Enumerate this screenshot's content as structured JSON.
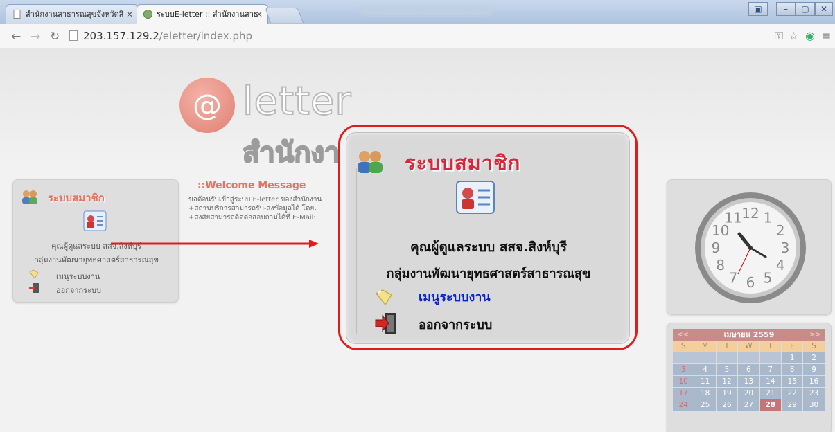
{
  "browser": {
    "tabs": [
      {
        "title": "สำนักงานสาธารณสุขจังหวัดสิ",
        "active": false
      },
      {
        "title": "ระบบE-letter :: สำนักงานสาธ",
        "active": true
      }
    ],
    "url_host": "203.157.129.2",
    "url_path": "/eletter/index.php"
  },
  "header": {
    "logo_symbol": "@",
    "logo_word": "letter",
    "logo_sub": "สำนักงาน"
  },
  "member_panel": {
    "title": "ระบบสมาชิก",
    "user_name": "คุณผู้ดูแลระบบ สสจ.สิงห์บุรี",
    "group": "กลุ่มงานพัฒนายุทธศาสตร์สาธารณสุข",
    "menu_label": "เมนูระบบงาน",
    "logout_label": "ออกจากระบบ"
  },
  "welcome": {
    "title": "::Welcome Message",
    "lines": [
      "ขอต้อนรับเข้าสู่ระบบ E-letter ของสำนักงาน",
      "+สถานบริการสามารถรับ-ส่งข้อมูลได้ โดยเ",
      "+สงสัยสามารถติดต่อสอบถามได้ที่ E-Mail:"
    ]
  },
  "calendar": {
    "month_title": "เมษายน 2559",
    "prev": "<<",
    "next": ">>",
    "weekdays": [
      "S",
      "M",
      "T",
      "W",
      "T",
      "F",
      "S"
    ],
    "weeks": [
      [
        "",
        "",
        "",
        "",
        "",
        "1",
        "2"
      ],
      [
        "3",
        "4",
        "5",
        "6",
        "7",
        "8",
        "9"
      ],
      [
        "10",
        "11",
        "12",
        "13",
        "14",
        "15",
        "16"
      ],
      [
        "17",
        "18",
        "19",
        "20",
        "21",
        "22",
        "23"
      ],
      [
        "24",
        "25",
        "26",
        "27",
        "28",
        "29",
        "30"
      ]
    ],
    "today": "28"
  },
  "clock": {
    "numbers": [
      "12",
      "1",
      "2",
      "3",
      "4",
      "5",
      "6",
      "7",
      "8",
      "9",
      "10",
      "11"
    ]
  },
  "colors": {
    "callout_border": "#e11c1c",
    "title_red": "#d8263a",
    "menu_blue": "#0a22c7"
  }
}
